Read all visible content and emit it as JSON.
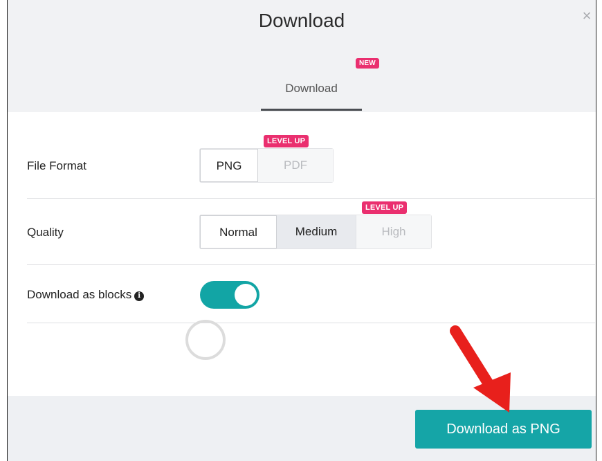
{
  "dialog": {
    "title": "Download",
    "close_glyph": "×"
  },
  "tabs": [
    {
      "label": "Download",
      "badge": "NEW",
      "active": true
    }
  ],
  "file_format": {
    "label": "File Format",
    "options": [
      "PNG",
      "PDF"
    ],
    "selected": "PNG",
    "locked_badge": "LEVEL UP"
  },
  "quality": {
    "label": "Quality",
    "options": [
      "Normal",
      "Medium",
      "High"
    ],
    "selected": "Medium",
    "locked_badge": "LEVEL UP"
  },
  "blocks": {
    "label": "Download as blocks",
    "info_glyph": "i",
    "enabled": true
  },
  "footer": {
    "button_label": "Download as PNG"
  },
  "colors": {
    "accent": "#15a5a7",
    "badge": "#ea2f6f",
    "arrow": "#e8201c"
  },
  "icons": {
    "close": "close-icon",
    "info": "info-icon",
    "arrow": "red-arrow-icon"
  }
}
